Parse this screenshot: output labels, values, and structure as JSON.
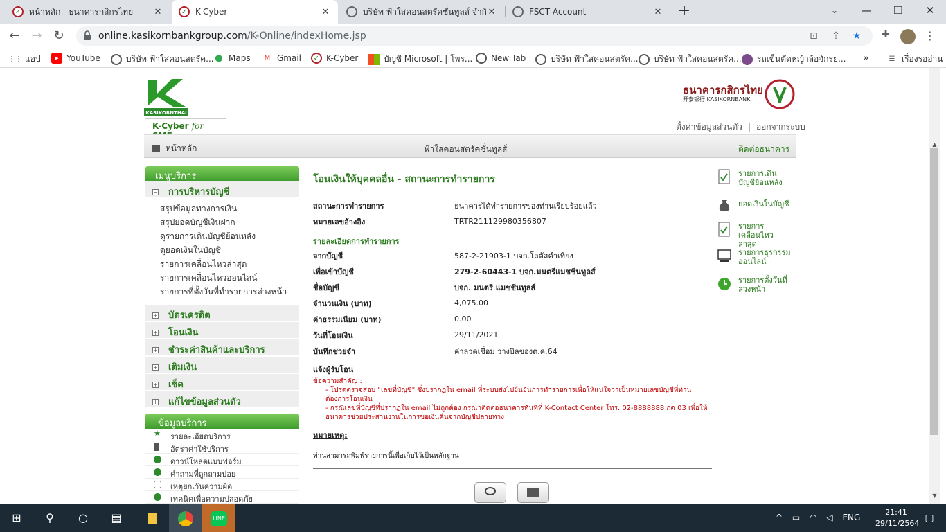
{
  "browser": {
    "tabs": [
      {
        "title": "หน้าหลัก - ธนาคารกสิกรไทย",
        "active": false
      },
      {
        "title": "K-Cyber",
        "active": true
      },
      {
        "title": "บริษัท ฟ้าใสคอนสตรัคชั่นทูลส์ จำกัด",
        "active": false
      },
      {
        "title": "FSCT Account",
        "active": false
      }
    ],
    "url_host": "online.kasikornbankgroup.com",
    "url_path": "/K-Online/indexHome.jsp",
    "bookmarks": [
      "แอป",
      "YouTube",
      "บริษัท ฟ้าใสคอนสตรัค...",
      "Maps",
      "Gmail",
      "K-Cyber",
      "บัญชี Microsoft | โพร...",
      "New Tab",
      "บริษัท ฟ้าใสคอนสตรัค...",
      "บริษัท ฟ้าใสคอนสตรัค...",
      "รถเข็นตัดหญ้าล้อจักรย..."
    ],
    "reading_list": "เรื่องรออ่าน"
  },
  "header": {
    "logo_text": "KASIKORNTHAI",
    "kcyber_prefix": "K-Cyber ",
    "kcyber_for": "for",
    "kcyber_suffix": " SME",
    "bank_name": "ธนาคารกสิกรไทย",
    "bank_sub": "开泰银行 KASIKORNBANK",
    "settings_link": "ตั้งค่าข้อมูลส่วนตัว",
    "separator": "|",
    "logout_link": "ออกจากระบบ"
  },
  "navbar": {
    "home": "หน้าหลัก",
    "company": "ฟ้าใสคอนสตรัคชั่นทูลส์",
    "contact": "ติดต่อธนาคาร"
  },
  "sidebar": {
    "menu_title": "เมนูบริการ",
    "account_mgmt": "การบริหารบัญชี",
    "account_items": [
      "สรุปข้อมูลทางการเงิน",
      "สรุปยอดบัญชีเงินฝาก",
      "ดูรายการเดินบัญชีย้อนหลัง",
      "ดูยอดเงินในบัญชี",
      "รายการเคลื่อนไหวล่าสุด",
      "รายการเคลื่อนไหวออนไลน์",
      "รายการที่ตั้งวันที่ทำรายการล่วงหน้า"
    ],
    "categories": [
      "บัตรเครดิต",
      "โอนเงิน",
      "ชำระค่าสินค้าและบริการ",
      "เติมเงิน",
      "เช็ค",
      "แก้ไขข้อมูลส่วนตัว"
    ],
    "services_title": "ข้อมูลบริการ",
    "services": [
      "รายละเอียดบริการ",
      "อัตราค่าใช้บริการ",
      "ดาวน์โหลดแบบฟอร์ม",
      "คำถามที่ถูกถามบ่อย",
      "เหตุยกเว้นความผิด",
      "เทคนิคเพื่อความปลอดภัย"
    ]
  },
  "main": {
    "title": "โอนเงินให้บุคคลอื่น - สถานะการทำรายการ",
    "status_label": "สถานะการทำรายการ",
    "status_value": "ธนาคารได้ทำรายการของท่านเรียบร้อยแล้ว",
    "ref_label": "หมายเลขอ้างอิง",
    "ref_value": "TRTR211129980356807",
    "details_title": "รายละเอียดการทำรายการ",
    "from_label": "จากบัญชี",
    "from_value": "587-2-21903-1 บจก.โลตัสคำเที่ยง",
    "to_label": "เพื่อเข้าบัญชี",
    "to_value": "279-2-60443-1 บจก.มนตรีแมชชีนทูลส์",
    "name_label": "ชื่อบัญชี",
    "name_value": "บจก. มนตรี แมชชีนทูลส์",
    "amount_label": "จำนวนเงิน (บาท)",
    "amount_value": "4,075.00",
    "fee_label": "ค่าธรรมเนียม (บาท)",
    "fee_value": "0.00",
    "date_label": "วันที่โอนเงิน",
    "date_value": "29/11/2021",
    "memo_label": "บันทึกช่วยจำ",
    "memo_value": "ค่าลวดเชื่อม วางบิลของต.ค.64",
    "notify_label": "แจ้งผู้รับโอน",
    "important_title": "ข้อความสำคัญ :",
    "important_1": "- โปรดตรวจสอบ \"เลขที่บัญชี\" ซึ่งปรากฏใน email ที่ระบบส่งไปยืนยันการทำรายการเพื่อให้แน่ใจว่าเป็นหมายเลขบัญชีที่ท่านต้องการโอนเงิน",
    "important_2": "- กรณีเลขที่บัญชีที่ปรากฏใน email ไม่ถูกต้อง กรุณาติดต่อธนาคารทันทีที่ K-Contact Center โทร. 02-8888888 กด 03 เพื่อให้ธนาคารช่วยประสานงานในการขอเงินคืนจากบัญชีปลายทาง",
    "remark_title": "หมายเหตุ:",
    "remark_text": "ท่านสามารถพิมพ์รายการนี้เพื่อเก็บไว้เป็นหลักฐาน"
  },
  "quicklinks": [
    "รายการเดินบัญชีย้อนหลัง",
    "ยอดเงินในบัญชี",
    "รายการเคลื่อนไหวล่าสุด",
    "รายการธุรกรรมออนไลน์",
    "รายการตั้งวันที่ล่วงหน้า"
  ],
  "taskbar": {
    "lang": "ENG",
    "time": "21:41",
    "date": "29/11/2564"
  },
  "colors": {
    "brand_green": "#2b7a1e",
    "kbank_red": "#8b1a1a",
    "alert_red": "#c00000"
  }
}
